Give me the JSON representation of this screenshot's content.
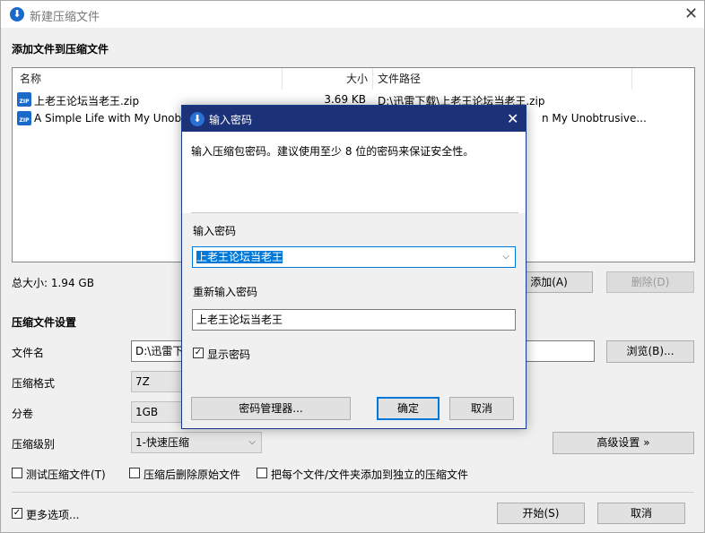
{
  "window": {
    "title": "新建压缩文件",
    "close_icon": "close-icon"
  },
  "files_section": {
    "heading": "添加文件到压缩文件",
    "columns": {
      "name": "名称",
      "size": "大小",
      "path": "文件路径"
    },
    "rows": [
      {
        "name": "上老王论坛当老王.zip",
        "size": "3.69 KB",
        "path": "D:\\迅雷下载\\上老王论坛当老王.zip"
      },
      {
        "name": "A Simple Life with My Unobt",
        "size": "",
        "path": "n My Unobtrusive..."
      }
    ],
    "total_size": "总大小: 1.94 GB",
    "add_button": "添加(A)",
    "delete_button": "删除(D)"
  },
  "settings": {
    "heading": "压缩文件设置",
    "filename_label": "文件名",
    "filename_value": "D:\\迅雷下",
    "browse_button": "浏览(B)...",
    "format_label": "压缩格式",
    "format_value": "7Z",
    "split_label": "分卷",
    "split_value": "1GB",
    "level_label": "压缩级别",
    "level_value": "1-快速压缩",
    "advanced_button": "高级设置 »",
    "test_checkbox": "测试压缩文件(T)",
    "delete_after_checkbox": "压缩后删除原始文件",
    "separate_checkbox": "把每个文件/文件夹添加到独立的压缩文件",
    "more_options_checkbox": "更多选项...",
    "more_options_checked": true,
    "start_button": "开始(S)",
    "cancel_button": "取消"
  },
  "dialog": {
    "title": "输入密码",
    "description": "输入压缩包密码。建议使用至少 8 位的密码来保证安全性。",
    "password_label": "输入密码",
    "password_value": "上老王论坛当老王",
    "confirm_label": "重新输入密码",
    "confirm_value": "上老王论坛当老王",
    "show_password_label": "显示密码",
    "show_password_checked": true,
    "manager_button": "密码管理器...",
    "ok_button": "确定",
    "cancel_button": "取消"
  },
  "colors": {
    "dialog_title_bg": "#1b3278",
    "selection": "#0078d7",
    "brand_icon": "#1b6ac9"
  }
}
